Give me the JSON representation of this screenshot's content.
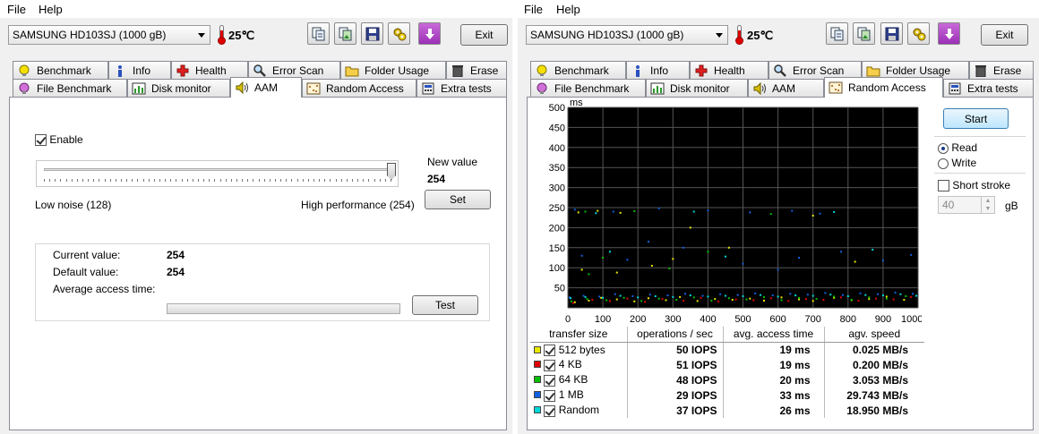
{
  "left": {
    "menu": {
      "file": "File",
      "help": "Help"
    },
    "drive": "SAMSUNG HD103SJ (1000 gB)",
    "temperature": "25℃",
    "exit_label": "Exit",
    "tabs_row1": [
      "Benchmark",
      "Info",
      "Health",
      "Error Scan",
      "Folder Usage",
      "Erase"
    ],
    "tabs_row2": [
      "File Benchmark",
      "Disk monitor",
      "AAM",
      "Random Access",
      "Extra tests"
    ],
    "active_tab": "AAM",
    "aam": {
      "enable_label": "Enable",
      "enabled": true,
      "slider_level": 254,
      "slider_min": 128,
      "slider_max": 254,
      "low_label": "Low noise (128)",
      "high_label": "High performance (254)",
      "new_value_label": "New value",
      "new_value": "254",
      "set_label": "Set",
      "current_label": "Current value:",
      "current_value": "254",
      "default_label": "Default value:",
      "default_value": "254",
      "avg_label": "Average access time:",
      "test_label": "Test",
      "progress": 0
    }
  },
  "right": {
    "menu": {
      "file": "File",
      "help": "Help"
    },
    "drive": "SAMSUNG HD103SJ (1000 gB)",
    "temperature": "25℃",
    "exit_label": "Exit",
    "tabs_row1": [
      "Benchmark",
      "Info",
      "Health",
      "Error Scan",
      "Folder Usage",
      "Erase"
    ],
    "tabs_row2": [
      "File Benchmark",
      "Disk monitor",
      "AAM",
      "Random Access",
      "Extra tests"
    ],
    "active_tab": "Random Access",
    "controls": {
      "start_label": "Start",
      "read_label": "Read",
      "write_label": "Write",
      "mode": "Read",
      "short_stroke_label": "Short stroke",
      "short_stroke": false,
      "stroke_value": "40",
      "stroke_unit": "gB"
    },
    "table": {
      "headers": [
        "transfer size",
        "operations / sec",
        "avg. access time",
        "agv. speed"
      ],
      "rows": [
        {
          "color": "#e8e800",
          "size": "512 bytes",
          "ops": "50 IOPS",
          "time": "19 ms",
          "speed": "0.025 MB/s"
        },
        {
          "color": "#e00000",
          "size": "4 KB",
          "ops": "51 IOPS",
          "time": "19 ms",
          "speed": "0.200 MB/s"
        },
        {
          "color": "#00c000",
          "size": "64 KB",
          "ops": "48 IOPS",
          "time": "20 ms",
          "speed": "3.053 MB/s"
        },
        {
          "color": "#1060e0",
          "size": "1 MB",
          "ops": "29 IOPS",
          "time": "33 ms",
          "speed": "29.743 MB/s"
        },
        {
          "color": "#00d8d8",
          "size": "Random",
          "ops": "37 IOPS",
          "time": "26 ms",
          "speed": "18.950 MB/s"
        }
      ]
    }
  },
  "chart_data": {
    "type": "scatter",
    "ylabel": "ms",
    "xlabel": "",
    "x_ticks": [
      "0",
      "100",
      "200",
      "300",
      "400",
      "500",
      "600",
      "700",
      "800",
      "900",
      "1000gB"
    ],
    "y_ticks": [
      "50",
      "100",
      "150",
      "200",
      "250",
      "300",
      "350",
      "400",
      "450",
      "500"
    ],
    "xlim": [
      0,
      1000
    ],
    "ylim": [
      0,
      500
    ],
    "grid": true,
    "series": [
      {
        "name": "512 bytes",
        "color": "#e8e800",
        "points": [
          [
            20,
            14
          ],
          [
            60,
            18
          ],
          [
            95,
            25
          ],
          [
            140,
            21
          ],
          [
            190,
            16
          ],
          [
            230,
            24
          ],
          [
            280,
            19
          ],
          [
            320,
            27
          ],
          [
            370,
            17
          ],
          [
            420,
            22
          ],
          [
            470,
            20
          ],
          [
            520,
            23
          ],
          [
            560,
            18
          ],
          [
            610,
            26
          ],
          [
            660,
            21
          ],
          [
            700,
            17
          ],
          [
            760,
            25
          ],
          [
            810,
            19
          ],
          [
            860,
            22
          ],
          [
            910,
            28
          ],
          [
            960,
            20
          ],
          [
            30,
            238
          ],
          [
            85,
            242
          ],
          [
            150,
            237
          ],
          [
            700,
            230
          ],
          [
            40,
            95
          ],
          [
            240,
            105
          ],
          [
            300,
            122
          ],
          [
            460,
            150
          ],
          [
            140,
            88
          ],
          [
            820,
            115
          ],
          [
            350,
            200
          ]
        ]
      },
      {
        "name": "4 KB",
        "color": "#e00000",
        "points": [
          [
            15,
            12
          ],
          [
            70,
            20
          ],
          [
            120,
            17
          ],
          [
            170,
            23
          ],
          [
            220,
            15
          ],
          [
            270,
            22
          ],
          [
            330,
            18
          ],
          [
            380,
            25
          ],
          [
            430,
            16
          ],
          [
            480,
            21
          ],
          [
            530,
            19
          ],
          [
            580,
            24
          ],
          [
            630,
            17
          ],
          [
            680,
            22
          ],
          [
            730,
            20
          ],
          [
            780,
            26
          ],
          [
            830,
            18
          ],
          [
            880,
            23
          ],
          [
            930,
            21
          ],
          [
            980,
            27
          ]
        ]
      },
      {
        "name": "64 KB",
        "color": "#00c000",
        "points": [
          [
            10,
            16
          ],
          [
            55,
            22
          ],
          [
            110,
            19
          ],
          [
            160,
            25
          ],
          [
            210,
            17
          ],
          [
            260,
            23
          ],
          [
            310,
            20
          ],
          [
            360,
            26
          ],
          [
            410,
            18
          ],
          [
            460,
            24
          ],
          [
            510,
            21
          ],
          [
            560,
            27
          ],
          [
            610,
            19
          ],
          [
            660,
            25
          ],
          [
            710,
            22
          ],
          [
            760,
            28
          ],
          [
            810,
            20
          ],
          [
            860,
            26
          ],
          [
            910,
            23
          ],
          [
            965,
            29
          ],
          [
            50,
            240
          ],
          [
            190,
            241
          ],
          [
            580,
            234
          ],
          [
            100,
            125
          ],
          [
            400,
            140
          ],
          [
            60,
            84
          ],
          [
            290,
            98
          ]
        ]
      },
      {
        "name": "1 MB",
        "color": "#1060e0",
        "points": [
          [
            5,
            26
          ],
          [
            45,
            30
          ],
          [
            90,
            28
          ],
          [
            135,
            34
          ],
          [
            185,
            29
          ],
          [
            235,
            33
          ],
          [
            285,
            31
          ],
          [
            335,
            35
          ],
          [
            385,
            30
          ],
          [
            435,
            34
          ],
          [
            485,
            32
          ],
          [
            535,
            36
          ],
          [
            585,
            31
          ],
          [
            635,
            35
          ],
          [
            685,
            33
          ],
          [
            735,
            37
          ],
          [
            785,
            32
          ],
          [
            835,
            36
          ],
          [
            885,
            34
          ],
          [
            935,
            38
          ],
          [
            985,
            35
          ],
          [
            20,
            245
          ],
          [
            130,
            240
          ],
          [
            260,
            248
          ],
          [
            400,
            243
          ],
          [
            520,
            238
          ],
          [
            640,
            242
          ],
          [
            720,
            235
          ],
          [
            40,
            130
          ],
          [
            170,
            120
          ],
          [
            330,
            150
          ],
          [
            500,
            110
          ],
          [
            660,
            125
          ],
          [
            780,
            140
          ],
          [
            900,
            118
          ],
          [
            980,
            132
          ],
          [
            230,
            165
          ],
          [
            600,
            95
          ]
        ]
      },
      {
        "name": "Random",
        "color": "#00d8d8",
        "points": [
          [
            8,
            24
          ],
          [
            50,
            27
          ],
          [
            100,
            25
          ],
          [
            150,
            30
          ],
          [
            200,
            26
          ],
          [
            250,
            29
          ],
          [
            300,
            27
          ],
          [
            350,
            31
          ],
          [
            400,
            28
          ],
          [
            450,
            30
          ],
          [
            500,
            29
          ],
          [
            550,
            32
          ],
          [
            600,
            28
          ],
          [
            650,
            31
          ],
          [
            700,
            30
          ],
          [
            750,
            33
          ],
          [
            800,
            29
          ],
          [
            850,
            32
          ],
          [
            900,
            31
          ],
          [
            950,
            34
          ],
          [
            995,
            30
          ],
          [
            80,
            236
          ],
          [
            360,
            240
          ],
          [
            760,
            239
          ],
          [
            120,
            140
          ],
          [
            450,
            128
          ],
          [
            870,
            145
          ]
        ]
      }
    ]
  }
}
